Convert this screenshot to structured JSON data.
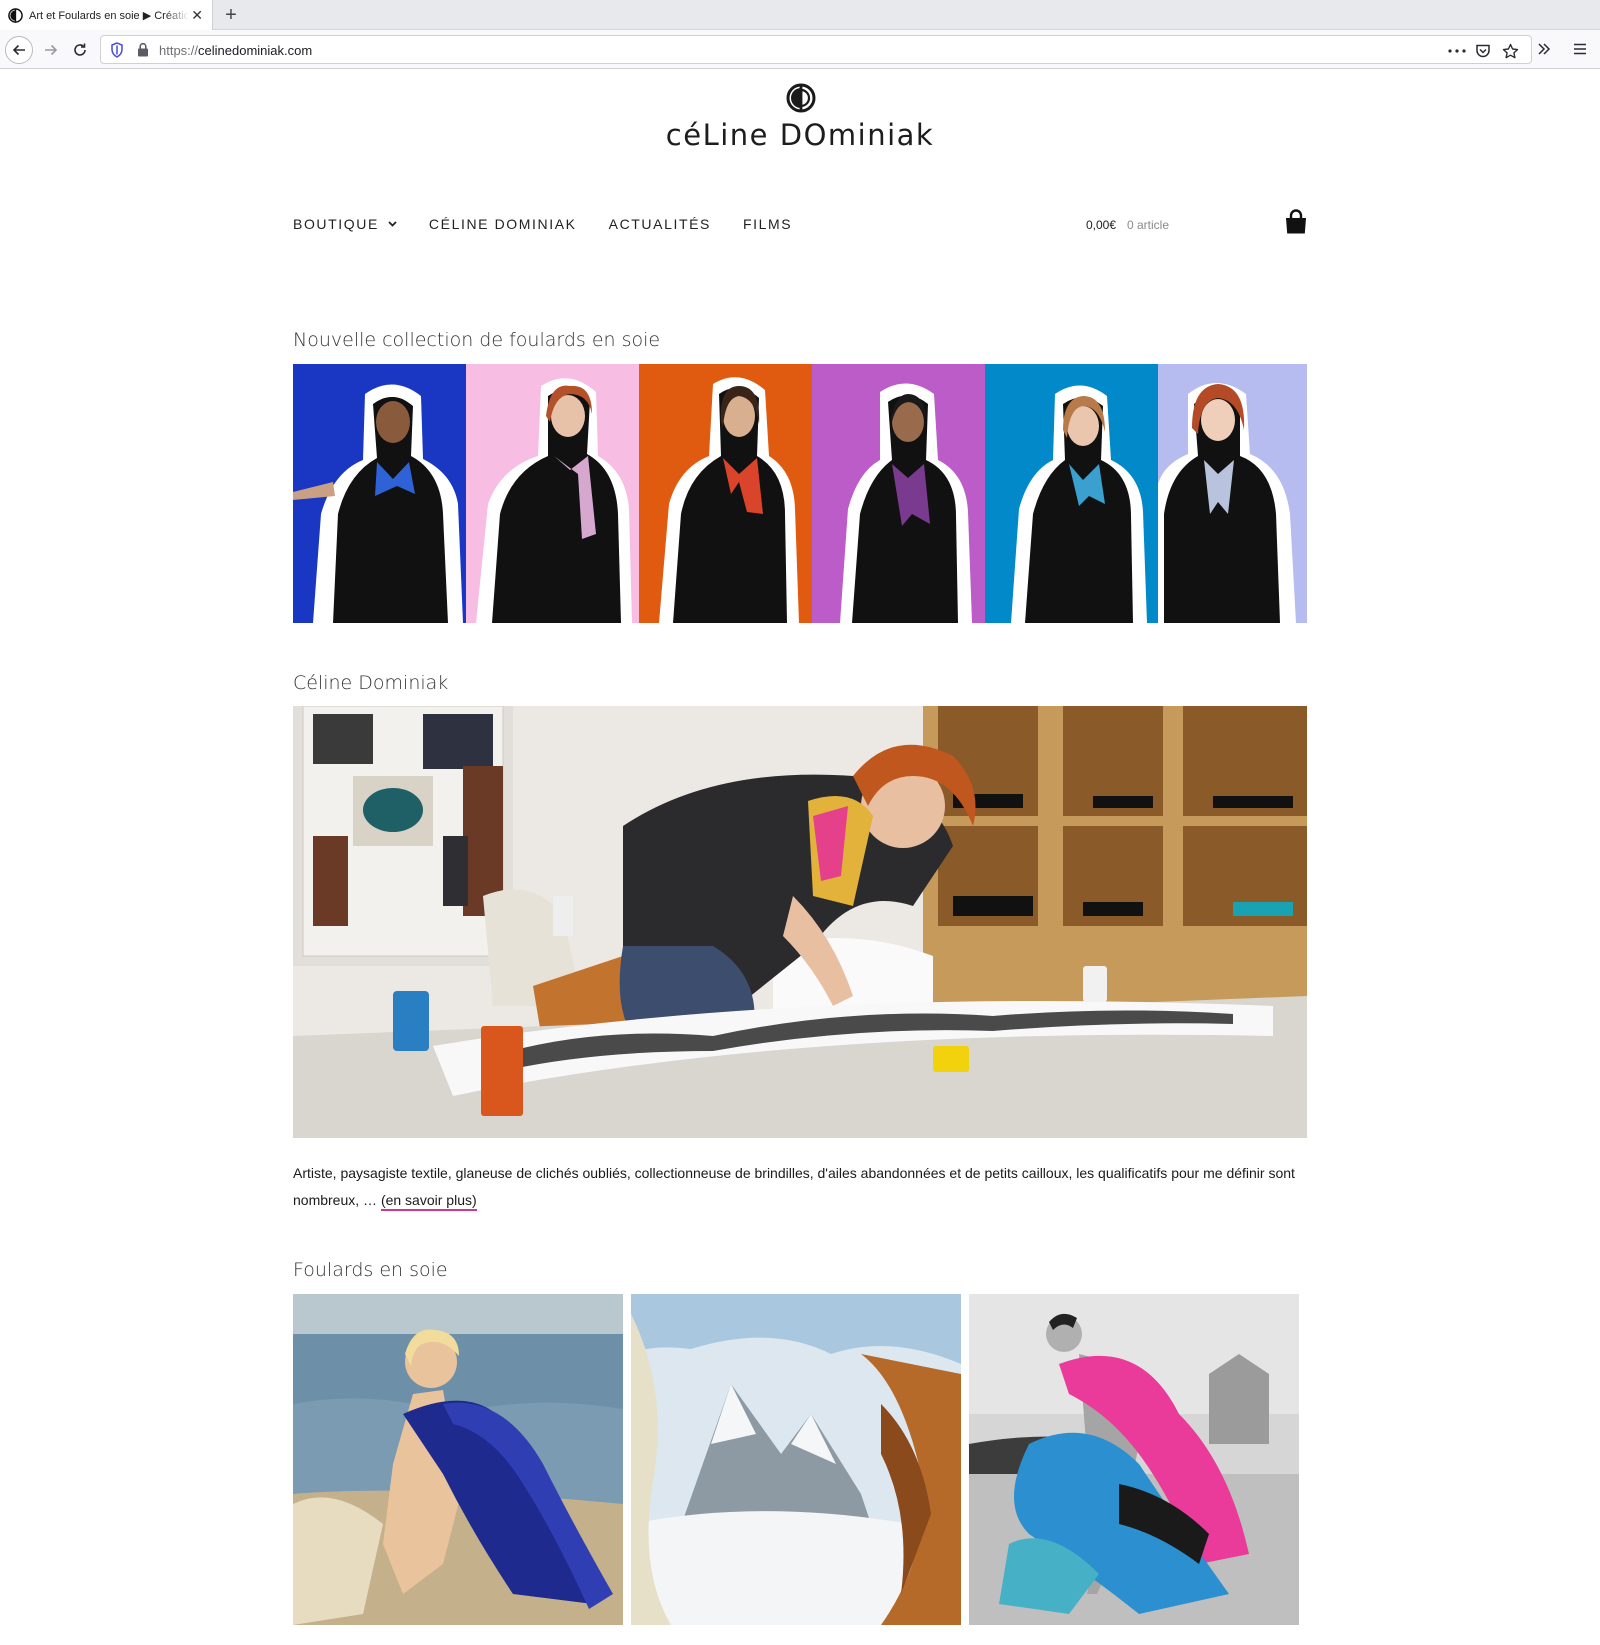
{
  "browser": {
    "tab_title": "Art et Foulards en soie ▶ Création",
    "url_scheme": "https://",
    "url_host": "celinedominiak.com"
  },
  "site": {
    "name": "céLine DOminiak",
    "nav": [
      {
        "label": "BOUTIQUE",
        "has_dropdown": true
      },
      {
        "label": "CÉLINE DOMINIAK"
      },
      {
        "label": "ACTUALITÉS"
      },
      {
        "label": "FILMS"
      }
    ],
    "cart": {
      "amount": "0,00€",
      "count": "0 article"
    }
  },
  "sections": {
    "collection": {
      "title": "Nouvelle collection de foulards en soie",
      "panel_colors": [
        "#1a37c4",
        "#f7bde3",
        "#e05a10",
        "#bb5cc8",
        "#0289c9",
        "#b6bcef"
      ],
      "scarf_colors": [
        "#2f62d6",
        "#d6a8d0",
        "#d9442a",
        "#7a3a8f",
        "#3aa0cf",
        "#b9c3dd"
      ]
    },
    "artist": {
      "title": "Céline Dominiak",
      "text": "Artiste, paysagiste textile, glaneuse de clichés oubliés, collectionneuse de brindilles, d'ailes abandonnées et de petits cailloux, les qualificatifs pour me définir sont nombreux, … ",
      "link": "(en savoir plus)"
    },
    "scarves": {
      "title": "Foulards en soie"
    }
  },
  "colors": {
    "accent_underline": "#d6338b",
    "text": "#222222"
  }
}
